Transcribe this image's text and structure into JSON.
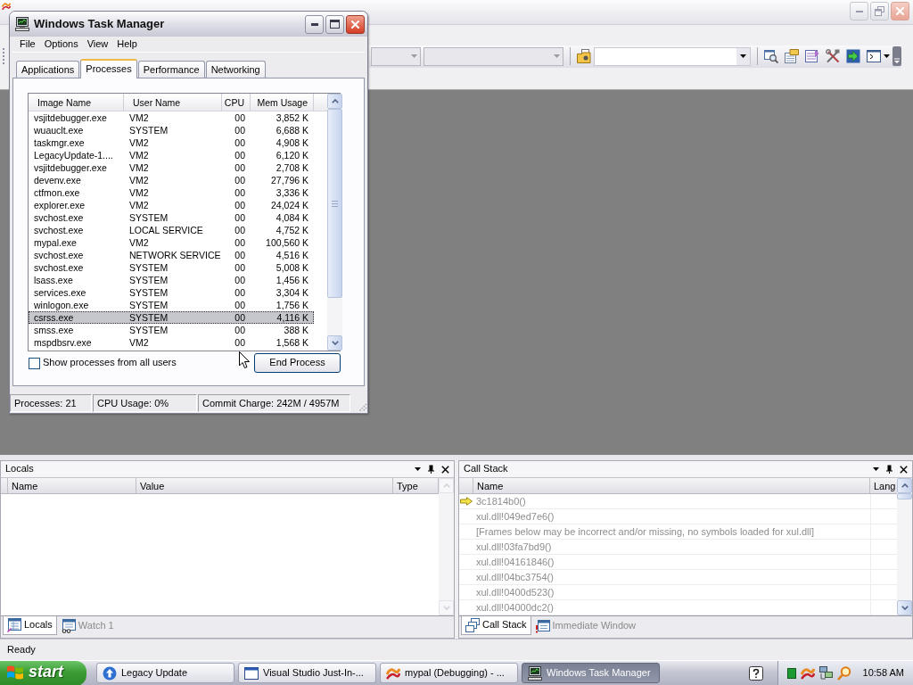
{
  "task_manager": {
    "title": "Windows Task Manager",
    "menu": [
      "File",
      "Options",
      "View",
      "Help"
    ],
    "tabs": [
      {
        "label": "Applications",
        "selected": false
      },
      {
        "label": "Processes",
        "selected": true
      },
      {
        "label": "Performance",
        "selected": false
      },
      {
        "label": "Networking",
        "selected": false
      }
    ],
    "columns": [
      "Image Name",
      "User Name",
      "CPU",
      "Mem Usage"
    ],
    "processes": [
      {
        "image": "vsjitdebugger.exe",
        "user": "VM2",
        "cpu": "00",
        "mem": "3,852 K",
        "selected": false
      },
      {
        "image": "wuauclt.exe",
        "user": "SYSTEM",
        "cpu": "00",
        "mem": "6,688 K",
        "selected": false
      },
      {
        "image": "taskmgr.exe",
        "user": "VM2",
        "cpu": "00",
        "mem": "4,908 K",
        "selected": false
      },
      {
        "image": "LegacyUpdate-1....",
        "user": "VM2",
        "cpu": "00",
        "mem": "6,120 K",
        "selected": false
      },
      {
        "image": "vsjitdebugger.exe",
        "user": "VM2",
        "cpu": "00",
        "mem": "2,708 K",
        "selected": false
      },
      {
        "image": "devenv.exe",
        "user": "VM2",
        "cpu": "00",
        "mem": "27,796 K",
        "selected": false
      },
      {
        "image": "ctfmon.exe",
        "user": "VM2",
        "cpu": "00",
        "mem": "3,336 K",
        "selected": false
      },
      {
        "image": "explorer.exe",
        "user": "VM2",
        "cpu": "00",
        "mem": "24,024 K",
        "selected": false
      },
      {
        "image": "svchost.exe",
        "user": "SYSTEM",
        "cpu": "00",
        "mem": "4,084 K",
        "selected": false
      },
      {
        "image": "svchost.exe",
        "user": "LOCAL SERVICE",
        "cpu": "00",
        "mem": "4,752 K",
        "selected": false
      },
      {
        "image": "mypal.exe",
        "user": "VM2",
        "cpu": "00",
        "mem": "100,560 K",
        "selected": false
      },
      {
        "image": "svchost.exe",
        "user": "NETWORK SERVICE",
        "cpu": "00",
        "mem": "4,516 K",
        "selected": false
      },
      {
        "image": "svchost.exe",
        "user": "SYSTEM",
        "cpu": "00",
        "mem": "5,008 K",
        "selected": false
      },
      {
        "image": "lsass.exe",
        "user": "SYSTEM",
        "cpu": "00",
        "mem": "1,456 K",
        "selected": false
      },
      {
        "image": "services.exe",
        "user": "SYSTEM",
        "cpu": "00",
        "mem": "3,304 K",
        "selected": false
      },
      {
        "image": "winlogon.exe",
        "user": "SYSTEM",
        "cpu": "00",
        "mem": "1,756 K",
        "selected": false
      },
      {
        "image": "csrss.exe",
        "user": "SYSTEM",
        "cpu": "00",
        "mem": "4,116 K",
        "selected": true
      },
      {
        "image": "smss.exe",
        "user": "SYSTEM",
        "cpu": "00",
        "mem": "388 K",
        "selected": false
      },
      {
        "image": "mspdbsrv.exe",
        "user": "VM2",
        "cpu": "00",
        "mem": "1,568 K",
        "selected": false
      }
    ],
    "show_all_users": {
      "label": "Show processes from all users",
      "checked": false
    },
    "end_button": "End Process",
    "status_bar": [
      "Processes: 21",
      "CPU Usage: 0%",
      "Commit Charge: 242M / 4957M"
    ]
  },
  "ide": {
    "toolbar": {
      "combos": [
        {
          "disabled": true
        },
        {
          "disabled": true
        },
        {
          "disabled": false
        }
      ]
    },
    "status": "Ready"
  },
  "locals": {
    "title": "Locals",
    "columns": [
      "Name",
      "Value",
      "Type"
    ],
    "tabs": [
      {
        "label": "Locals",
        "selected": true
      },
      {
        "label": "Watch 1",
        "selected": false
      }
    ]
  },
  "call_stack": {
    "title": "Call Stack",
    "columns": [
      "Name",
      "Lang"
    ],
    "rows": [
      {
        "name": "3c1814b0()",
        "current": true
      },
      {
        "name": "xul.dll!049ed7e6()",
        "current": false
      },
      {
        "name": "[Frames below may be incorrect and/or missing, no symbols loaded for xul.dll]",
        "current": false
      },
      {
        "name": "xul.dll!03fa7bd9()",
        "current": false
      },
      {
        "name": "xul.dll!04161846()",
        "current": false
      },
      {
        "name": "xul.dll!04bc3754()",
        "current": false
      },
      {
        "name": "xul.dll!0400d523()",
        "current": false
      },
      {
        "name": "xul.dll!04000dc2()",
        "current": false
      }
    ],
    "tabs": [
      {
        "label": "Call Stack",
        "selected": true
      },
      {
        "label": "Immediate Window",
        "selected": false
      }
    ]
  },
  "taskbar": {
    "start": "start",
    "tasks": [
      {
        "label": "Legacy Update",
        "selected": false
      },
      {
        "label": "Visual Studio Just-In-...",
        "selected": false
      },
      {
        "label": "mypal (Debugging) - ...",
        "selected": false
      },
      {
        "label": "Windows Task Manager",
        "selected": true
      }
    ],
    "clock": "10:58 AM"
  }
}
